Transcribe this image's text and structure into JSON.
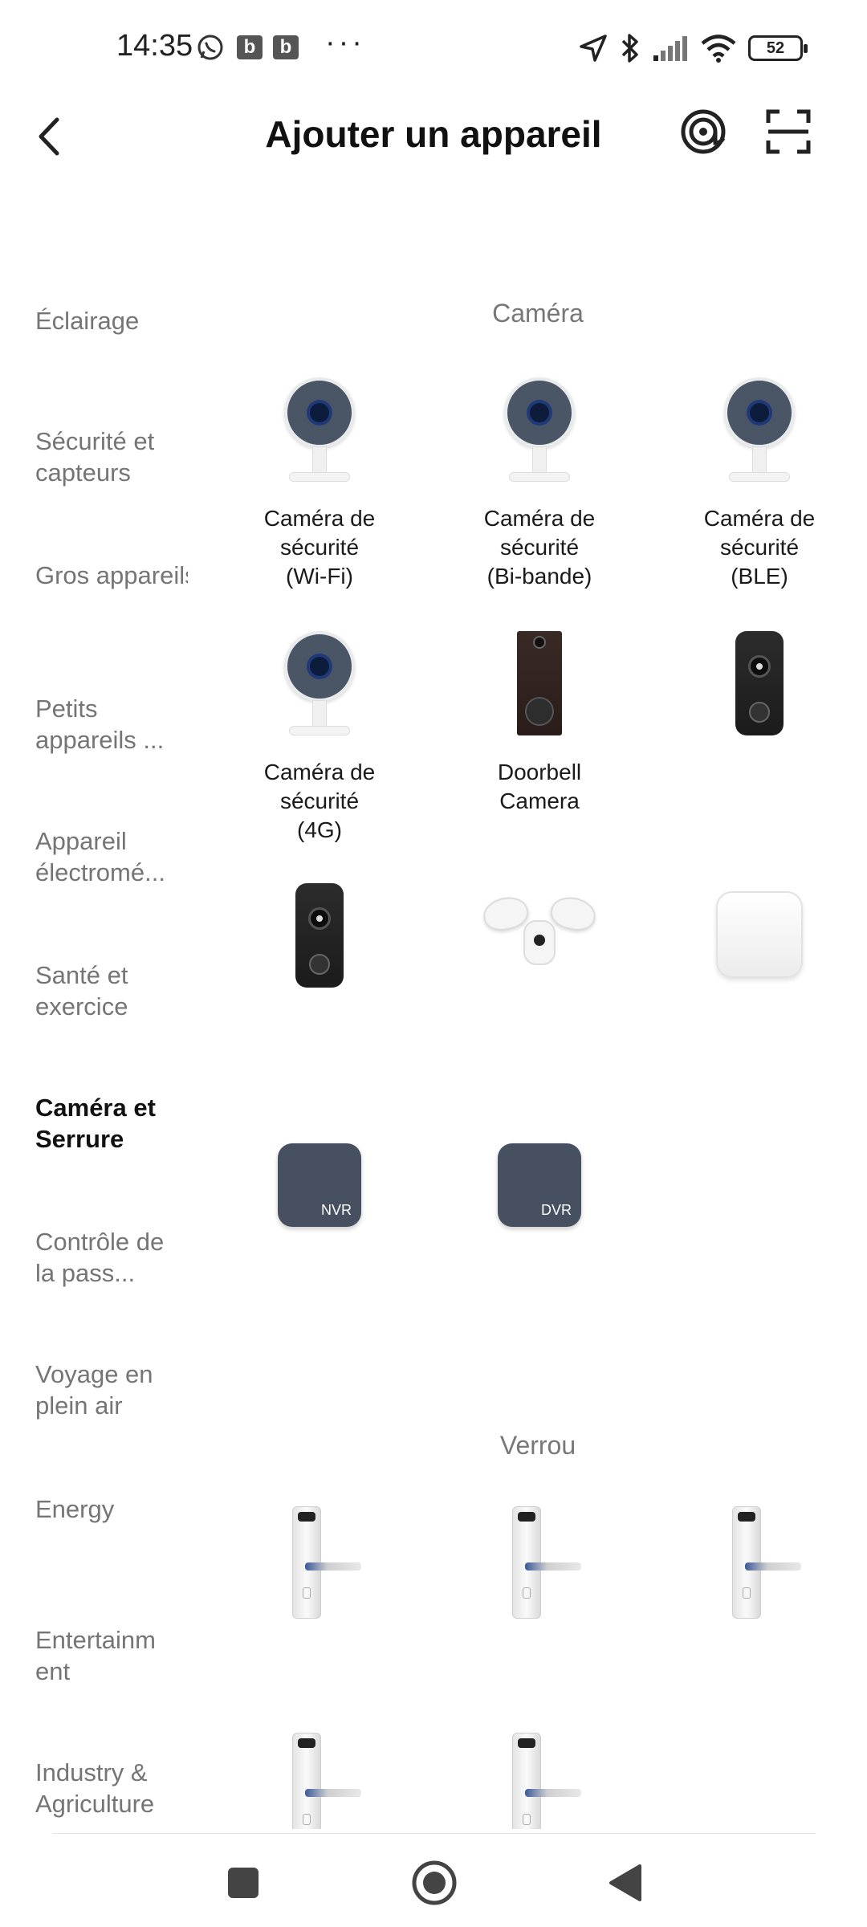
{
  "status_bar": {
    "time": "14:35",
    "notif_b1": "b",
    "notif_b2": "b",
    "more": "···",
    "battery": "52"
  },
  "header": {
    "title": "Ajouter un appareil"
  },
  "sidebar": {
    "items": [
      {
        "label": "Éclairage"
      },
      {
        "label": "Sécurité et capteurs"
      },
      {
        "label": "Gros appareils ..."
      },
      {
        "label": "Petits appareils ..."
      },
      {
        "label": "Appareil électromé..."
      },
      {
        "label": "Santé et exercice"
      },
      {
        "label": "Caméra et Serrure",
        "active": true
      },
      {
        "label": "Contrôle de la pass..."
      },
      {
        "label": "Voyage en plein air"
      },
      {
        "label": "Energy"
      },
      {
        "label": "Entertainm ent"
      },
      {
        "label": "Industry & Agriculture"
      }
    ]
  },
  "main": {
    "camera_section": {
      "title": "Caméra",
      "devices": [
        {
          "line1": "Caméra de",
          "line2": "sécurité",
          "line3": "(Wi-Fi)"
        },
        {
          "line1": "Caméra de",
          "line2": "sécurité",
          "line3": "(Bi-bande)"
        },
        {
          "line1": "Caméra de",
          "line2": "sécurité",
          "line3": "(BLE)"
        },
        {
          "line1": "Caméra de",
          "line2": "sécurité",
          "line3": "(4G)"
        },
        {
          "line1": "Doorbell",
          "line2": "Camera"
        }
      ],
      "nvr_label": "NVR",
      "dvr_label": "DVR"
    },
    "lock_section": {
      "title": "Verrou"
    }
  },
  "icons": {
    "back": "back-arrow-icon",
    "scan_target": "at-target-icon",
    "scan_qr": "scan-frame-icon",
    "nav_recent": "square-icon",
    "nav_home": "circle-icon",
    "nav_back": "triangle-back-icon"
  },
  "colors": {
    "active_text": "#111111",
    "inactive_text": "#757575",
    "section_title": "#777777",
    "recorder": "#465060"
  }
}
